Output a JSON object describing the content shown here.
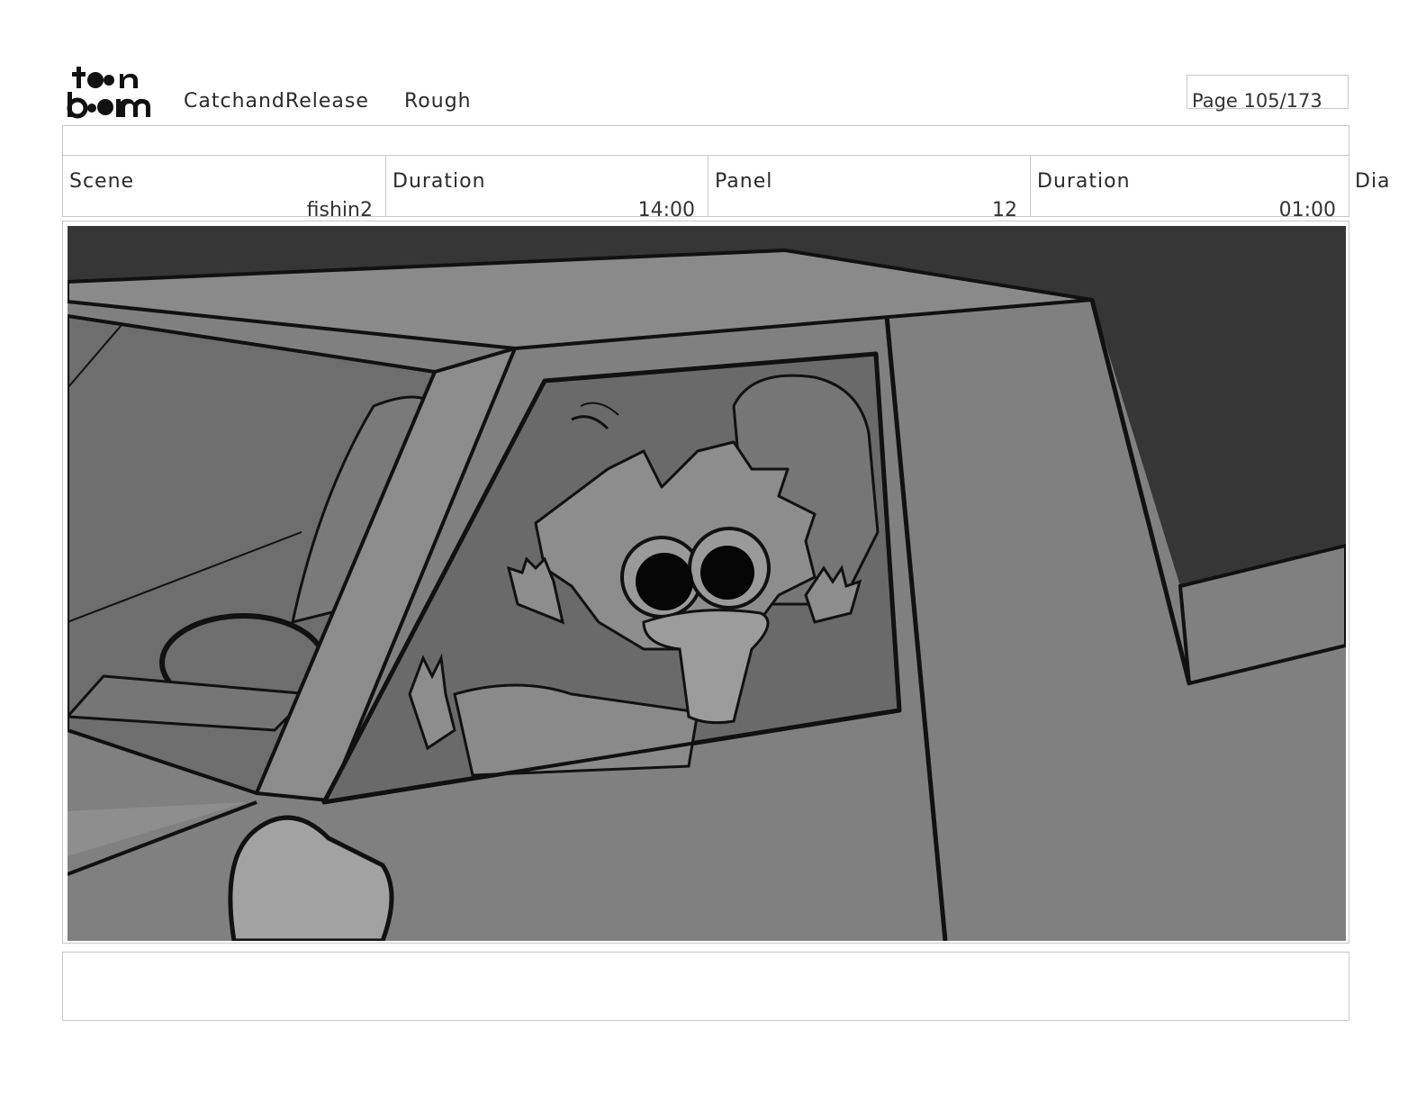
{
  "header": {
    "project": "CatchandRelease",
    "stage": "Rough",
    "page": "Page 105/173"
  },
  "info": {
    "scene_label": "Scene",
    "scene_value": "fishin2",
    "scene_duration_label": "Duration",
    "scene_duration_value": "14:00",
    "panel_label": "Panel",
    "panel_value": "12",
    "panel_duration_label": "Duration",
    "panel_duration_value": "01:00",
    "dialogue_label": "Dia"
  },
  "logo": {
    "icon": "toonboom-logo",
    "text_top": "toon",
    "text_bottom": "boom"
  },
  "panel": {
    "icon": "storyboard-drawing-character-waving-from-car-window"
  },
  "colors": {
    "frame_border": "#c8c8c8",
    "sky": "#363636",
    "car_body": "#808080",
    "window": "#6a6a6a"
  }
}
